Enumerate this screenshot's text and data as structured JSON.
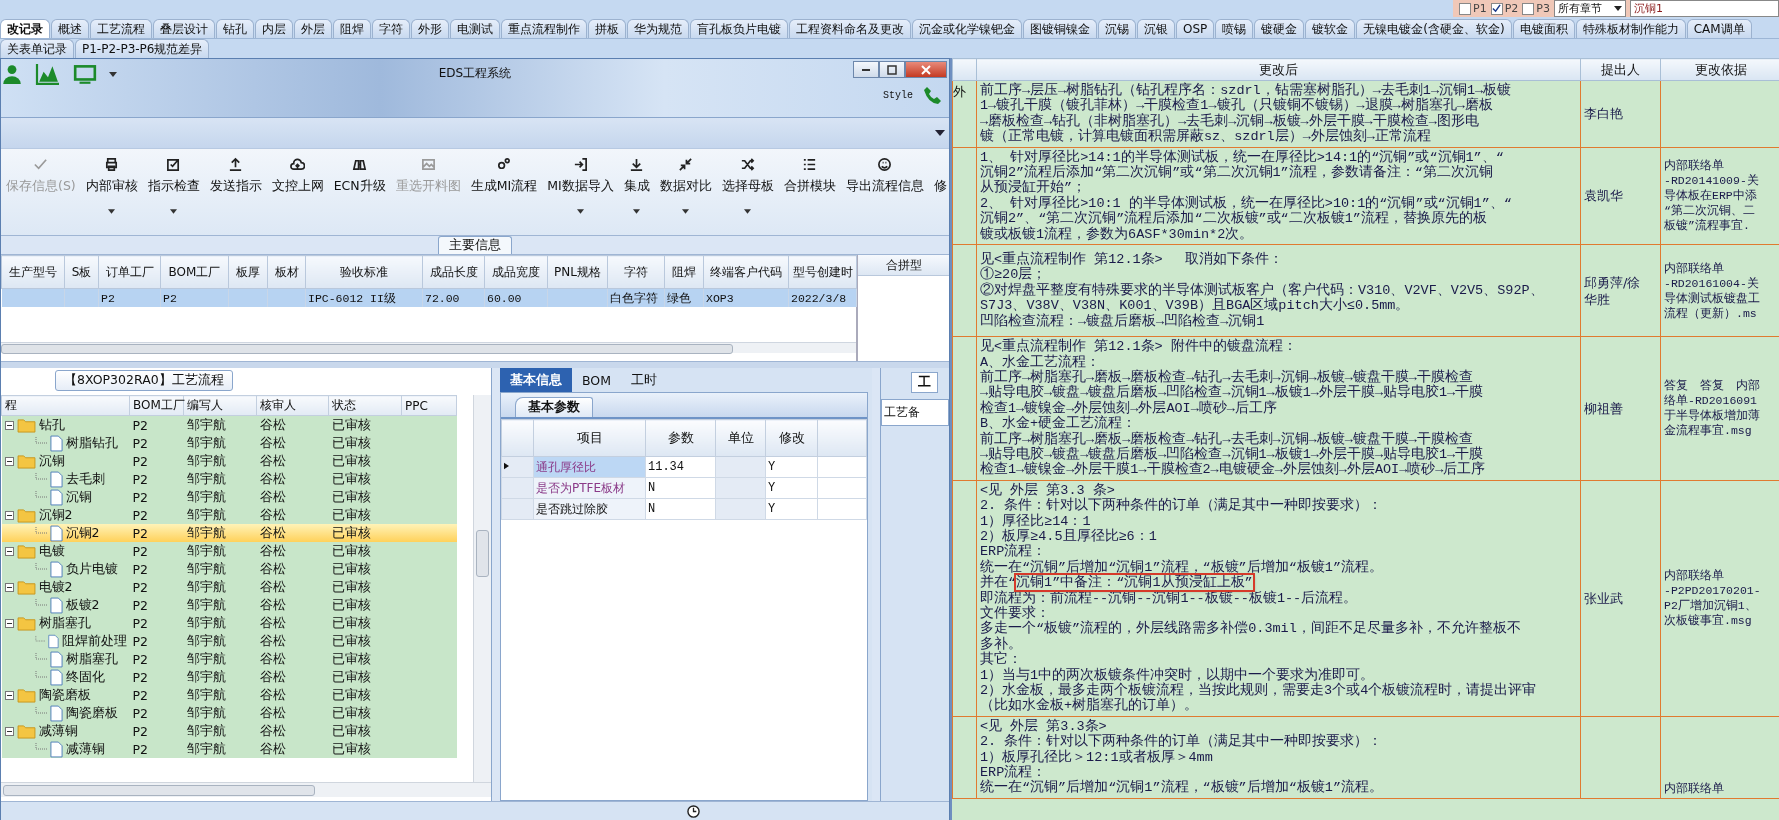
{
  "filter": {
    "options": [
      {
        "label": "P1",
        "checked": false
      },
      {
        "label": "P2",
        "checked": true
      },
      {
        "label": "P3",
        "checked": false
      }
    ],
    "chapter": "所有章节",
    "search": "沉铜1"
  },
  "tabs": [
    {
      "label": "改记录",
      "selected": true
    },
    {
      "label": "概述",
      "selected": false
    },
    {
      "label": "工艺流程",
      "selected": false
    },
    {
      "label": "叠层设计",
      "selected": false
    },
    {
      "label": "钻孔",
      "selected": false
    },
    {
      "label": "内层",
      "selected": false
    },
    {
      "label": "外层",
      "selected": false
    },
    {
      "label": "阻焊",
      "selected": false
    },
    {
      "label": "字符",
      "selected": false
    },
    {
      "label": "外形",
      "selected": false
    },
    {
      "label": "电测试",
      "selected": false
    },
    {
      "label": "重点流程制作",
      "selected": false
    },
    {
      "label": "拼板",
      "selected": false
    },
    {
      "label": "华为规范",
      "selected": false
    },
    {
      "label": "盲孔板负片电镀",
      "selected": false
    },
    {
      "label": "工程资料命名及更改",
      "selected": false
    },
    {
      "label": "沉金或化学镍钯金",
      "selected": false
    },
    {
      "label": "图镀铜镍金",
      "selected": false
    },
    {
      "label": "沉锡",
      "selected": false
    },
    {
      "label": "沉银",
      "selected": false
    },
    {
      "label": "OSP",
      "selected": false
    },
    {
      "label": "喷锡",
      "selected": false
    },
    {
      "label": "镀硬金",
      "selected": false
    },
    {
      "label": "镀软金",
      "selected": false
    },
    {
      "label": "无镍电镀金(含硬金、软金)",
      "selected": false
    },
    {
      "label": "电镀面积",
      "selected": false
    },
    {
      "label": "特殊板材制作能力",
      "selected": false
    },
    {
      "label": "CAM调单",
      "selected": false
    }
  ],
  "subtabs": [
    {
      "label": "关表单记录",
      "selected": false
    },
    {
      "label": "P1-P2-P3-P6规范差异",
      "selected": false
    }
  ],
  "window": {
    "title": "EDS工程系统",
    "style_menu": "Style",
    "ribbon_buttons": [
      {
        "label": "保存信息(S)",
        "disabled": true,
        "has_menu": false
      },
      {
        "label": "内部审核",
        "disabled": false,
        "has_menu": true
      },
      {
        "label": "指示检查",
        "disabled": false,
        "has_menu": true
      },
      {
        "label": "发送指示",
        "disabled": false,
        "has_menu": false
      },
      {
        "label": "文控上网",
        "disabled": false,
        "has_menu": false
      },
      {
        "label": "ECN升级",
        "disabled": false,
        "has_menu": false
      },
      {
        "label": "重选开料图",
        "disabled": true,
        "has_menu": false
      },
      {
        "label": "生成MI流程",
        "disabled": false,
        "has_menu": false
      },
      {
        "label": "MI数据导入",
        "disabled": false,
        "has_menu": true
      },
      {
        "label": "集成",
        "disabled": false,
        "has_menu": true
      },
      {
        "label": "数据对比",
        "disabled": false,
        "has_menu": true
      },
      {
        "label": "选择母板",
        "disabled": false,
        "has_menu": true
      },
      {
        "label": "合拼模块",
        "disabled": false,
        "has_menu": false
      },
      {
        "label": "导出流程信息",
        "disabled": false,
        "has_menu": false
      },
      {
        "label": "修",
        "disabled": false,
        "has_menu": false
      }
    ],
    "group_label": "主要信息",
    "grid": {
      "columns": [
        "生产型号",
        "S板",
        "订单工厂",
        "BOM工厂",
        "板厚",
        "板材",
        "验收标准",
        "成品长度",
        "成品宽度",
        "PNL规格",
        "字符",
        "阻焊",
        "终端客户代码",
        "型号创建时"
      ],
      "rows": [
        {
          "selected": true,
          "cells": [
            "",
            "",
            "P2",
            "P2",
            "",
            "",
            "IPC-6012 II级",
            "72.00",
            "60.00",
            "",
            "白色字符",
            "绿色",
            "XOP3",
            "2022/3/8"
          ]
        }
      ]
    },
    "side_panel": {
      "title": "合拼型"
    },
    "process_tab": "【8XOP302RA0】工艺流程",
    "tree": {
      "columns": [
        "程",
        "BOM工厂",
        "编写人",
        "核审人",
        "状态",
        "PPC"
      ],
      "nodes": [
        {
          "name": "钻孔",
          "bom": "P2",
          "author": "邹宇航",
          "reviewer": "谷松",
          "status": "已审核",
          "selected": false,
          "expanded": true,
          "children": [
            {
              "name": "树脂钻孔",
              "bom": "P2",
              "author": "邹宇航",
              "reviewer": "谷松",
              "status": "已审核",
              "selected": false
            }
          ]
        },
        {
          "name": "沉铜",
          "bom": "P2",
          "author": "邹宇航",
          "reviewer": "谷松",
          "status": "已审核",
          "selected": false,
          "expanded": true,
          "children": [
            {
              "name": "去毛刺",
              "bom": "P2",
              "author": "邹宇航",
              "reviewer": "谷松",
              "status": "已审核",
              "selected": false
            },
            {
              "name": "沉铜",
              "bom": "P2",
              "author": "邹宇航",
              "reviewer": "谷松",
              "status": "已审核",
              "selected": false
            }
          ]
        },
        {
          "name": "沉铜2",
          "bom": "P2",
          "author": "邹宇航",
          "reviewer": "谷松",
          "status": "已审核",
          "selected": false,
          "expanded": true,
          "children": [
            {
              "name": "沉铜2",
              "bom": "P2",
              "author": "邹宇航",
              "reviewer": "谷松",
              "status": "已审核",
              "selected": true
            }
          ]
        },
        {
          "name": "电镀",
          "bom": "P2",
          "author": "邹宇航",
          "reviewer": "谷松",
          "status": "已审核",
          "selected": false,
          "expanded": true,
          "children": [
            {
              "name": "负片电镀",
              "bom": "P2",
              "author": "邹宇航",
              "reviewer": "谷松",
              "status": "已审核",
              "selected": false
            }
          ]
        },
        {
          "name": "电镀2",
          "bom": "P2",
          "author": "邹宇航",
          "reviewer": "谷松",
          "status": "已审核",
          "selected": false,
          "expanded": true,
          "children": [
            {
              "name": "板镀2",
              "bom": "P2",
              "author": "邹宇航",
              "reviewer": "谷松",
              "status": "已审核",
              "selected": false
            }
          ]
        },
        {
          "name": "树脂塞孔",
          "bom": "P2",
          "author": "邹宇航",
          "reviewer": "谷松",
          "status": "已审核",
          "selected": false,
          "expanded": true,
          "children": [
            {
              "name": "阻焊前处理",
              "bom": "P2",
              "author": "邹宇航",
              "reviewer": "谷松",
              "status": "已审核",
              "selected": false
            },
            {
              "name": "树脂塞孔",
              "bom": "P2",
              "author": "邹宇航",
              "reviewer": "谷松",
              "status": "已审核",
              "selected": false
            },
            {
              "name": "终固化",
              "bom": "P2",
              "author": "邹宇航",
              "reviewer": "谷松",
              "status": "已审核",
              "selected": false
            }
          ]
        },
        {
          "name": "陶瓷磨板",
          "bom": "P2",
          "author": "邹宇航",
          "reviewer": "谷松",
          "status": "已审核",
          "selected": false,
          "expanded": true,
          "children": [
            {
              "name": "陶瓷磨板",
              "bom": "P2",
              "author": "邹宇航",
              "reviewer": "谷松",
              "status": "已审核",
              "selected": false
            }
          ]
        },
        {
          "name": "减薄铜",
          "bom": "P2",
          "author": "邹宇航",
          "reviewer": "谷松",
          "status": "已审核",
          "selected": false,
          "expanded": true,
          "children": [
            {
              "name": "减薄铜",
              "bom": "P2",
              "author": "邹宇航",
              "reviewer": "谷松",
              "status": "已审核",
              "selected": false
            }
          ]
        }
      ]
    },
    "detail": {
      "tabs": [
        {
          "label": "基本信息",
          "selected": true
        },
        {
          "label": "BOM",
          "selected": false
        },
        {
          "label": "工时",
          "selected": false
        }
      ],
      "subtab": "基本参数",
      "columns": [
        "项目",
        "参数",
        "单位",
        "修改"
      ],
      "rows": [
        {
          "item": "通孔厚径比",
          "value": "11.34",
          "unit": "",
          "modified": "Y",
          "flagged": true,
          "current": true
        },
        {
          "item": "是否为PTFE板材",
          "value": "N",
          "unit": "",
          "modified": "Y",
          "flagged": true,
          "current": false
        },
        {
          "item": "是否跳过除胶",
          "value": "N",
          "unit": "",
          "modified": "Y",
          "flagged": false,
          "current": false
        }
      ]
    },
    "side_stub": {
      "tab": "工",
      "label": "工艺备"
    }
  },
  "changes": {
    "columns": [
      "更改后",
      "提出人",
      "更改依据"
    ],
    "rows": [
      {
        "edge": "外",
        "lines": [
          {
            "text": "前工序→层压→树脂钻孔（钻孔程序名：szdrl，钻需塞树脂孔）→去毛刺1→沉铜1→板镀"
          },
          {
            "text": "1→镀孔干膜（镀孔菲林）→干膜检查1→镀孔（只镀铜不镀锡）→退膜→树脂塞孔→磨板"
          },
          {
            "text": "→磨板检查→钻孔（非树脂塞孔）→去毛刺→沉铜→板镀→外层干膜→干膜检查→图形电"
          },
          {
            "text": "镀（正常电镀，计算电镀面积需屏蔽sz、szdrl层）→外层蚀刻→正常流程"
          }
        ],
        "proposer": [
          "李白艳"
        ],
        "basis": []
      },
      {
        "lines": [
          {
            "text": "1、 针对厚径比>14:1的半导体测试板，统一在厚径比>14:1的“沉铜”或“沉铜1”、“"
          },
          {
            "text": "沉铜2”流程后添加“第二次沉铜”或“第二次沉铜1”流程，参数请备注：“第二次沉铜"
          },
          {
            "text": "从预浸缸开始”；"
          },
          {
            "text": "2、 针对厚径比>10:1 的半导体测试板，统一在厚径比>10:1的“沉铜”或“沉铜1”、“"
          },
          {
            "text": "沉铜2”、“第二次沉铜”流程后添加“二次板镀”或“二次板镀1”流程，替换原先的板"
          },
          {
            "text": "镀或板镀1流程，参数为6ASF*30min*2次。"
          }
        ],
        "proposer": [
          "袁凯华"
        ],
        "basis": [
          "内部联络单",
          "-RD20141009-关",
          "导体板在ERP中添",
          "“第二次沉铜、二",
          "板镀”流程事宜."
        ]
      },
      {
        "lines": [
          {
            "text": "见<重点流程制作 第12.1条>　 取消如下条件："
          },
          {
            "text": "①≥20层；"
          },
          {
            "text": "②对焊盘平整度有特殊要求的半导体测试板客户（客户代码：V310、V2VF、V2V5、S92P、"
          },
          {
            "text": "S7J3、V38V、V38N、K001、V39B）且BGA区域pitch大小≤0.5mm。"
          },
          {
            "text": "凹陷检查流程：→镀盘后磨板→凹陷检查→沉铜1"
          }
        ],
        "proposer": [
          "邱勇萍/徐",
          "华胜"
        ],
        "basis": [
          "内部联络单",
          "-RD20161004-关",
          "导体测试板镀盘工",
          "流程（更新）.ms"
        ]
      },
      {
        "lines": [
          {
            "text": "见<重点流程制作 第12.1条> 附件中的镀盘流程："
          },
          {
            "text": "A、水金工艺流程："
          },
          {
            "text": "前工序→树脂塞孔→磨板→磨板检查→钻孔→去毛刺→沉铜→板镀→镀盘干膜→干膜检查"
          },
          {
            "text": "→贴导电胶→镀盘→镀盘后磨板→凹陷检查→沉铜1→板镀1→外层干膜→贴导电胶1→干膜"
          },
          {
            "text": "检查1→镀镍金→外层蚀刻→外层AOI→喷砂→后工序"
          },
          {
            "text": "B、水金+硬金工艺流程："
          },
          {
            "text": "前工序→树脂塞孔→磨板→磨板检查→钻孔→去毛刺→沉铜→板镀→镀盘干膜→干膜检查"
          },
          {
            "text": "→贴导电胶→镀盘→镀盘后磨板→凹陷检查→沉铜1→板镀1→外层干膜→贴导电胶1→干膜"
          },
          {
            "text": "检查1→镀镍金→外层干膜1→干膜检查2→电镀硬金→外层蚀刻→外层AOI→喷砂→后工序"
          }
        ],
        "proposer": [
          "柳祖善"
        ],
        "basis": [
          "答复　答复　内部",
          "络单-RD2016091",
          "于半导体板增加薄",
          "金流程事宜.msg"
        ]
      },
      {
        "lines": [
          {
            "text": "<见 外层 第3.3 条>"
          },
          {
            "text": "2. 条件：针对以下两种条件的订单（满足其中一种即按要求）："
          },
          {
            "text": "1）厚径比≥14：1"
          },
          {
            "text": "2）板厚≥4.5且厚径比≥6：1"
          },
          {
            "text": "ERP流程："
          },
          {
            "text": "统一在“沉铜”后增加“沉铜1”流程，“板镀”后增加“板镀1”流程。"
          },
          {
            "text": "并在“",
            "marked": "沉铜1”中备注：“沉铜1从预浸缸上板”"
          },
          {
            "text": "即流程为：前流程--沉铜--沉铜1--板镀--板镀1--后流程。"
          },
          {
            "text": "文件要求："
          },
          {
            "text": "多走一个“板镀”流程的，外层线路需多补偿0.3mil，间距不足尽量多补，不允许整板不"
          },
          {
            "text": "多补。"
          },
          {
            "text": "其它："
          },
          {
            "text": "1）当与1中的两次板镀条件冲突时，以期中一个要求为准即可。"
          },
          {
            "text": "2）水金板，最多走两个板镀流程，当按此规则，需要走3个或4个板镀流程时，请提出评审"
          },
          {
            "text": "（比如水金板+树脂塞孔的订单）。"
          }
        ],
        "proposer": [
          "张业武"
        ],
        "basis": [
          "内部联络单",
          "-P2PD20170201-",
          "P2厂增加沉铜1、",
          "次板镀事宜.msg"
        ]
      },
      {
        "lines": [
          {
            "text": "<见 外层  第3.3条>"
          },
          {
            "text": "2. 条件：针对以下两种条件的订单（满足其中一种即按要求）："
          },
          {
            "text": "1）板厚孔径比＞12:1或者板厚＞4mm"
          },
          {
            "text": "ERP流程："
          },
          {
            "text": "统一在“沉铜”后增加“沉铜1”流程，“板镀”后增加“板镀1”流程。"
          }
        ],
        "proposer": [],
        "basis": [
          "内部联络单"
        ]
      }
    ]
  }
}
